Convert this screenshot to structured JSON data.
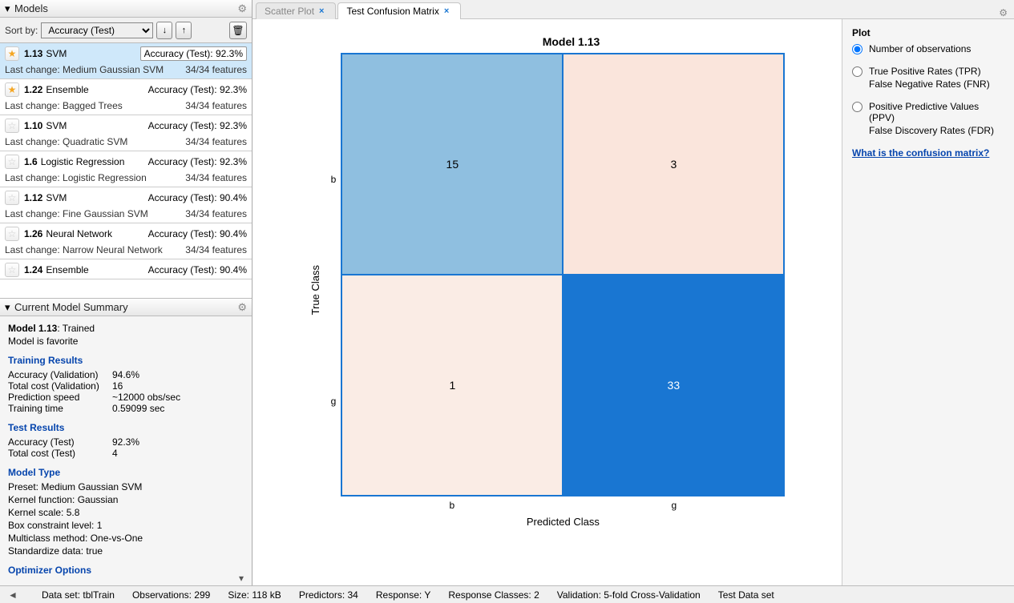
{
  "sidebar": {
    "models_title": "Models",
    "sort_label": "Sort by:",
    "sort_value": "Accuracy (Test)",
    "items": [
      {
        "fav": true,
        "id": "1.13",
        "type": "SVM",
        "acc_label": "Accuracy (Test): 92.3%",
        "boxed": true,
        "change": "Last change: Medium Gaussian SVM",
        "feat": "34/34 features",
        "selected": true
      },
      {
        "fav": true,
        "id": "1.22",
        "type": "Ensemble",
        "acc_label": "Accuracy (Test): 92.3%",
        "boxed": false,
        "change": "Last change: Bagged Trees",
        "feat": "34/34 features",
        "selected": false
      },
      {
        "fav": false,
        "id": "1.10",
        "type": "SVM",
        "acc_label": "Accuracy (Test): 92.3%",
        "boxed": false,
        "change": "Last change: Quadratic SVM",
        "feat": "34/34 features",
        "selected": false
      },
      {
        "fav": false,
        "id": "1.6",
        "type": "Logistic Regression",
        "acc_label": "Accuracy (Test): 92.3%",
        "boxed": false,
        "change": "Last change: Logistic Regression",
        "feat": "34/34 features",
        "selected": false
      },
      {
        "fav": false,
        "id": "1.12",
        "type": "SVM",
        "acc_label": "Accuracy (Test): 90.4%",
        "boxed": false,
        "change": "Last change: Fine Gaussian SVM",
        "feat": "34/34 features",
        "selected": false
      },
      {
        "fav": false,
        "id": "1.26",
        "type": "Neural Network",
        "acc_label": "Accuracy (Test): 90.4%",
        "boxed": false,
        "change": "Last change: Narrow Neural Network",
        "feat": "34/34 features",
        "selected": false
      },
      {
        "fav": false,
        "id": "1.24",
        "type": "Ensemble",
        "acc_label": "Accuracy (Test): 90.4%",
        "boxed": false,
        "change": "",
        "feat": "",
        "selected": false
      }
    ],
    "summary_title": "Current Model Summary",
    "summary": {
      "model_line": "Model 1.13",
      "trained": ": Trained",
      "fav_line": "Model is favorite",
      "training_header": "Training Results",
      "acc_val_k": "Accuracy (Validation)",
      "acc_val_v": "94.6%",
      "cost_val_k": "Total cost (Validation)",
      "cost_val_v": "16",
      "pred_speed_k": "Prediction speed",
      "pred_speed_v": "~12000 obs/sec",
      "train_time_k": "Training time",
      "train_time_v": "0.59099 sec",
      "test_header": "Test Results",
      "acc_test_k": "Accuracy (Test)",
      "acc_test_v": "92.3%",
      "cost_test_k": "Total cost (Test)",
      "cost_test_v": "4",
      "type_header": "Model Type",
      "preset": "Preset: Medium Gaussian SVM",
      "kernel_fn": "Kernel function: Gaussian",
      "kernel_scale": "Kernel scale: 5.8",
      "box_constraint": "Box constraint level: 1",
      "multiclass": "Multiclass method: One-vs-One",
      "standardize": "Standardize data: true",
      "optimizer_header": "Optimizer Options"
    }
  },
  "tabs": {
    "scatter": "Scatter Plot",
    "confmat": "Test Confusion Matrix"
  },
  "plot_panel": {
    "title": "Plot",
    "opt1": "Number of observations",
    "opt2a": "True Positive Rates (TPR)",
    "opt2b": "False Negative Rates (FNR)",
    "opt3a": "Positive Predictive Values (PPV)",
    "opt3b": "False Discovery Rates (FDR)",
    "help": "What is the confusion matrix?"
  },
  "chart": {
    "title": "Model 1.13",
    "ylabel": "True Class",
    "xlabel": "Predicted Class",
    "class1": "b",
    "class2": "g"
  },
  "chart_data": {
    "type": "heatmap",
    "title": "Model 1.13",
    "xlabel": "Predicted Class",
    "ylabel": "True Class",
    "x_categories": [
      "b",
      "g"
    ],
    "y_categories": [
      "b",
      "g"
    ],
    "values": [
      [
        15,
        3
      ],
      [
        1,
        33
      ]
    ],
    "colors": [
      [
        "#8fbfe0",
        "#fae5dc"
      ],
      [
        "#faece5",
        "#1976d2"
      ]
    ],
    "annotation": "Confusion matrix, number of observations"
  },
  "status": {
    "dataset": "Data set: tblTrain",
    "obs": "Observations: 299",
    "size": "Size: 118 kB",
    "pred": "Predictors: 34",
    "resp": "Response: Y",
    "respcls": "Response Classes: 2",
    "valid": "Validation: 5-fold Cross-Validation",
    "testset": "Test Data set"
  }
}
